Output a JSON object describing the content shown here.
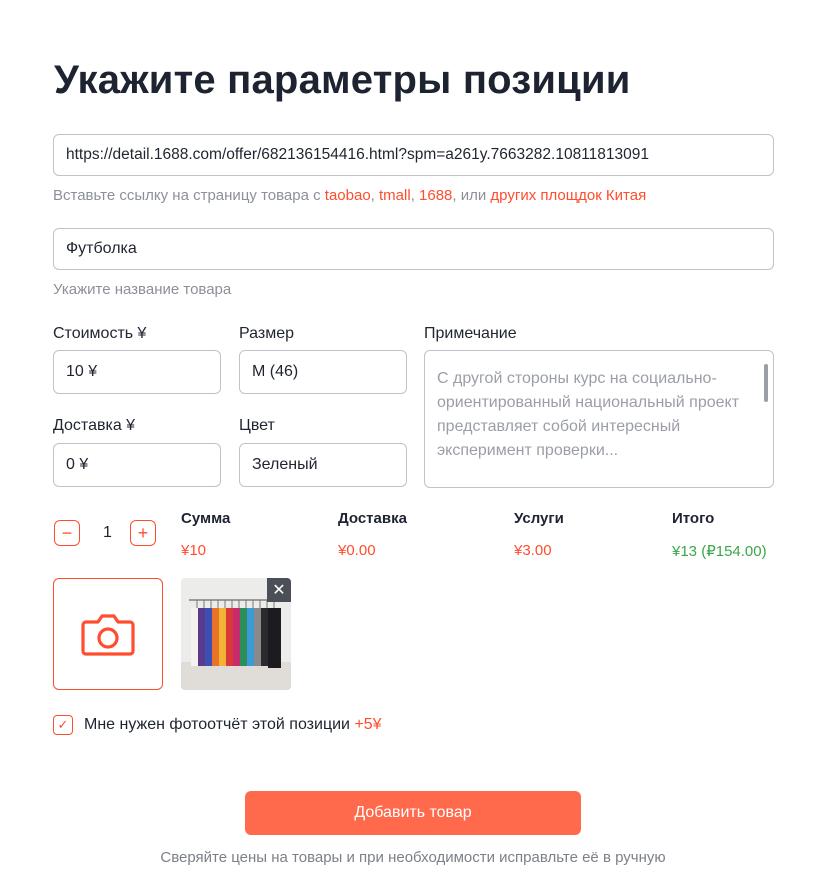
{
  "page": {
    "title": "Укажите параметры позиции"
  },
  "link": {
    "value": "https://detail.1688.com/offer/682136154416.html?spm=a261y.7663282.10811813091",
    "hint_prefix": "Вставьте ссылку на страницу товара с ",
    "hint_taobao": "taobao",
    "hint_sep1": ", ",
    "hint_tmall": "tmall",
    "hint_sep2": ", ",
    "hint_1688": "1688",
    "hint_sep3": ", или ",
    "hint_other": "других площдок Китая"
  },
  "name": {
    "value": "Футболка",
    "hint": "Укажите название товара"
  },
  "cost": {
    "label": "Стоимость ¥",
    "value": "10 ¥"
  },
  "size": {
    "label": "Размер",
    "value": "M (46)"
  },
  "delivery": {
    "label": "Доставка ¥",
    "value": "0 ¥"
  },
  "color": {
    "label": "Цвет",
    "value": "Зеленый"
  },
  "note": {
    "label": "Примечание",
    "value": "С другой стороны курс на социально-ориентированный национальный проект представляет собой интересный эксперимент проверки..."
  },
  "quantity": {
    "minus": "−",
    "value": "1",
    "plus": "+"
  },
  "summary": [
    {
      "title": "Сумма",
      "value": "¥10",
      "color": "#ff4d2e"
    },
    {
      "title": "Доставка",
      "value": "¥0.00",
      "color": "#ff4d2e"
    },
    {
      "title": "Услуги",
      "value": "¥3.00",
      "color": "#ff4d2e"
    },
    {
      "title": "Итого",
      "value": "¥13 (₽154.00)",
      "color": "#3aa64a"
    }
  ],
  "photos": {
    "upload_icon": "camera-icon",
    "remove_icon": "close-icon",
    "remove_glyph": "✕"
  },
  "photo_report": {
    "checked": true,
    "check_glyph": "✓",
    "label": "Мне нужен фотоотчёт этой позиции ",
    "extra": "+5¥"
  },
  "actions": {
    "submit": "Добавить товар"
  },
  "footer": {
    "text": "Сверяйте цены на товары и при необходимости исправльте её в ручную"
  },
  "colors": {
    "accent": "#ff4d2e",
    "button": "#ff6a4d",
    "total": "#3aa64a"
  }
}
